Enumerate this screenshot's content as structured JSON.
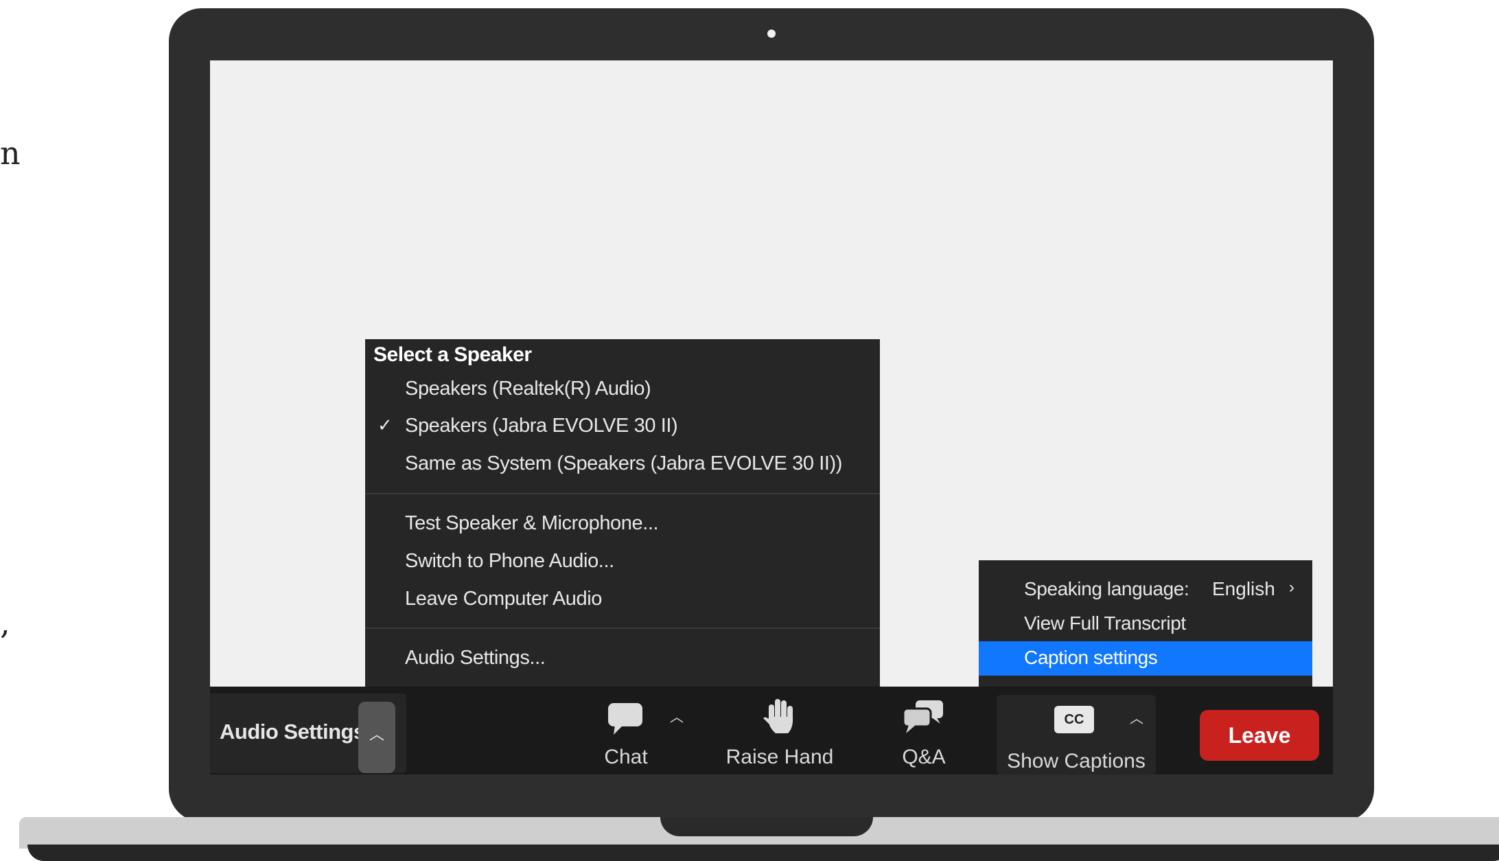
{
  "edge_text": {
    "top": "n",
    "bottom": ","
  },
  "speaker_menu": {
    "header": "Select a Speaker",
    "speakers": [
      {
        "label": "Speakers (Realtek(R) Audio)",
        "checked": false
      },
      {
        "label": "Speakers (Jabra EVOLVE 30 II)",
        "checked": true
      },
      {
        "label": "Same as System (Speakers (Jabra EVOLVE 30 II))",
        "checked": false
      }
    ],
    "check_mark": "✓",
    "actions": [
      "Test Speaker & Microphone...",
      "Switch to Phone Audio...",
      "Leave Computer Audio"
    ],
    "settings": "Audio Settings..."
  },
  "caption_menu": {
    "speaking_language_label": "Speaking language:",
    "speaking_language_value": "English",
    "view_transcript": "View Full Transcript",
    "caption_settings": "Caption settings",
    "selected_color": "#1177ff"
  },
  "toolbar": {
    "audio_settings": "Audio Settings",
    "chat": "Chat",
    "raise_hand": "Raise Hand",
    "qa": "Q&A",
    "cc_badge": "CC",
    "show_captions": "Show Captions",
    "leave": "Leave",
    "leave_color": "#c9211e"
  }
}
